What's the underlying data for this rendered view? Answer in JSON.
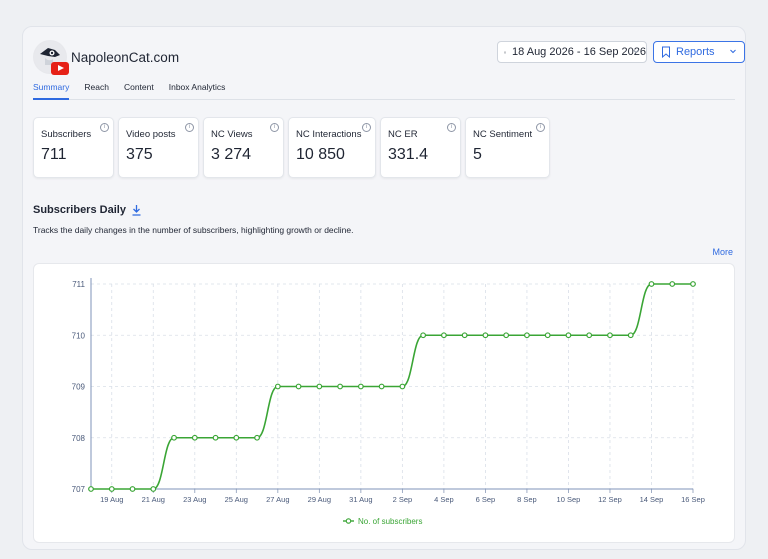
{
  "header": {
    "brand_name": "NapoleonCat.com",
    "date_range": "18 Aug 2026 - 16 Sep 2026",
    "reports_label": "Reports"
  },
  "tabs": [
    {
      "label": "Summary",
      "active": true
    },
    {
      "label": "Reach",
      "active": false
    },
    {
      "label": "Content",
      "active": false
    },
    {
      "label": "Inbox Analytics",
      "active": false
    }
  ],
  "metrics": [
    {
      "label": "Subscribers",
      "value": "711"
    },
    {
      "label": "Video posts",
      "value": "375"
    },
    {
      "label": "NC Views",
      "value": "3 274"
    },
    {
      "label": "NC Interactions",
      "value": "10 850"
    },
    {
      "label": "NC ER",
      "value": "331.4"
    },
    {
      "label": "NC Sentiment",
      "value": "5"
    }
  ],
  "section": {
    "title": "Subscribers Daily",
    "description": "Tracks the daily changes in the number of subscribers, highlighting growth or decline.",
    "more_label": "More"
  },
  "colors": {
    "accent": "#2f6ae0",
    "series": "#3aa535",
    "youtube": "#e62117"
  },
  "chart_data": {
    "type": "line",
    "x": [
      "18 Aug",
      "19 Aug",
      "20 Aug",
      "21 Aug",
      "22 Aug",
      "23 Aug",
      "24 Aug",
      "25 Aug",
      "26 Aug",
      "27 Aug",
      "28 Aug",
      "29 Aug",
      "30 Aug",
      "31 Aug",
      "1 Sep",
      "2 Sep",
      "3 Sep",
      "4 Sep",
      "5 Sep",
      "6 Sep",
      "7 Sep",
      "8 Sep",
      "9 Sep",
      "10 Sep",
      "11 Sep",
      "12 Sep",
      "13 Sep",
      "14 Sep",
      "15 Sep",
      "16 Sep"
    ],
    "x_tick_labels": [
      "19 Aug",
      "21 Aug",
      "23 Aug",
      "25 Aug",
      "27 Aug",
      "29 Aug",
      "31 Aug",
      "2 Sep",
      "4 Sep",
      "6 Sep",
      "8 Sep",
      "10 Sep",
      "12 Sep",
      "14 Sep",
      "16 Sep"
    ],
    "series": [
      {
        "name": "No. of subscribers",
        "values": [
          707,
          707,
          707,
          707,
          708,
          708,
          708,
          708,
          708,
          709,
          709,
          709,
          709,
          709,
          709,
          709,
          710,
          710,
          710,
          710,
          710,
          710,
          710,
          710,
          710,
          710,
          710,
          711,
          711,
          711
        ]
      }
    ],
    "yticks": [
      707,
      708,
      709,
      710,
      711
    ],
    "ylim": [
      707,
      711
    ],
    "grid": true,
    "legend": "bottom-center"
  }
}
